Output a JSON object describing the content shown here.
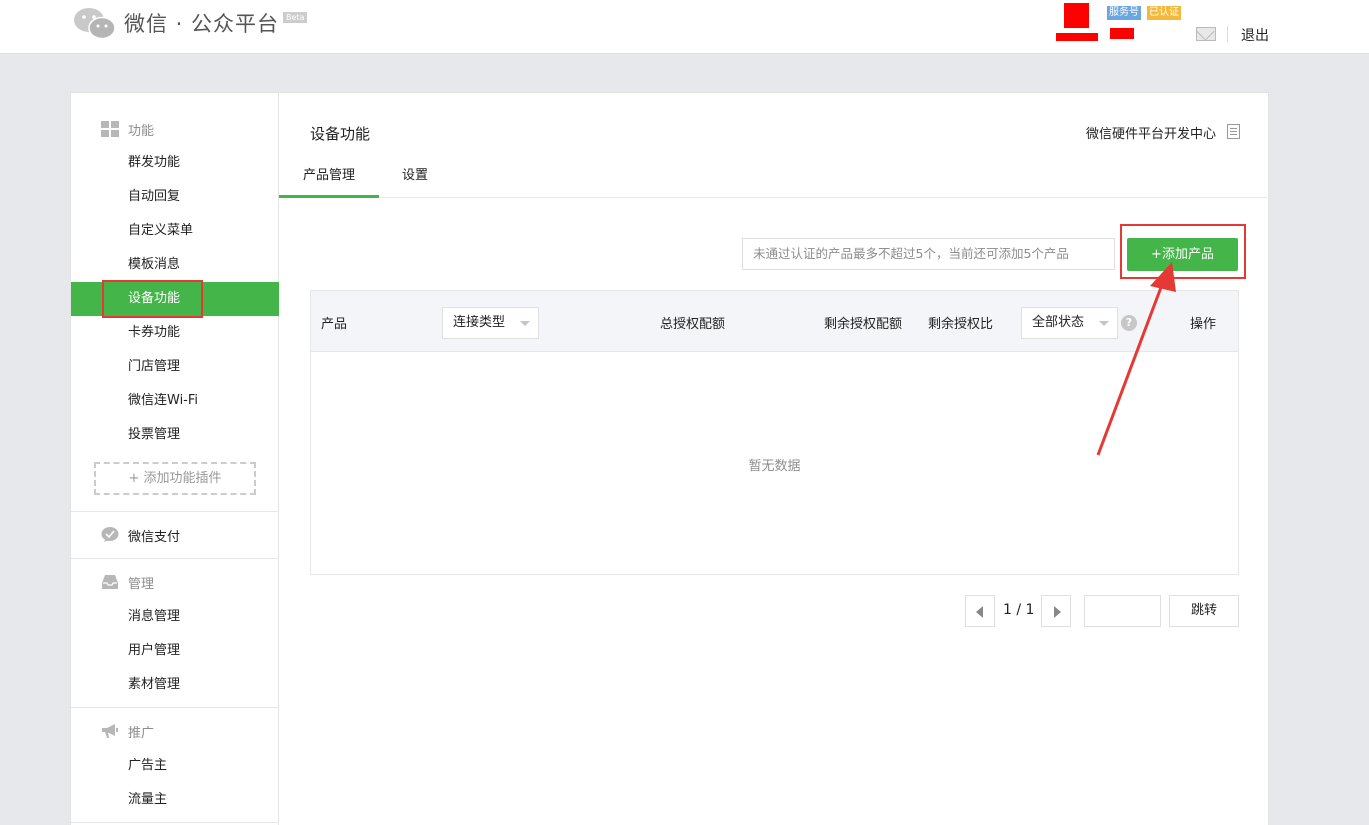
{
  "header": {
    "logo_title": "微信 · 公众平台",
    "beta": "Beta",
    "tag_service": "服务号",
    "tag_certified": "已认证",
    "logout": "退出"
  },
  "sidebar": {
    "group_function": "功能",
    "function_items": [
      "群发功能",
      "自动回复",
      "自定义菜单",
      "模板消息",
      "设备功能",
      "卡券功能",
      "门店管理",
      "微信连Wi-Fi",
      "投票管理"
    ],
    "add_plugin": "+ 添加功能插件",
    "group_pay": "微信支付",
    "group_manage": "管理",
    "manage_items": [
      "消息管理",
      "用户管理",
      "素材管理"
    ],
    "group_promo": "推广",
    "promo_items": [
      "广告主",
      "流量主"
    ]
  },
  "main": {
    "title": "设备功能",
    "dev_link": "微信硬件平台开发中心",
    "tabs": [
      "产品管理",
      "设置"
    ],
    "notice": "未通过认证的产品最多不超过5个，当前还可添加5个产品",
    "add_button": "+添加产品",
    "table": {
      "col_product": "产品",
      "col_connect": "连接类型",
      "col_total": "总授权配额",
      "col_remaining": "剩余授权配额",
      "col_ratio": "剩余授权比",
      "col_status": "全部状态",
      "col_action": "操作",
      "empty": "暂无数据"
    },
    "pager": {
      "page": "1 / 1",
      "jump": "跳转"
    }
  },
  "colors": {
    "accent_green": "#44b549",
    "highlight_red": "#e53935"
  }
}
